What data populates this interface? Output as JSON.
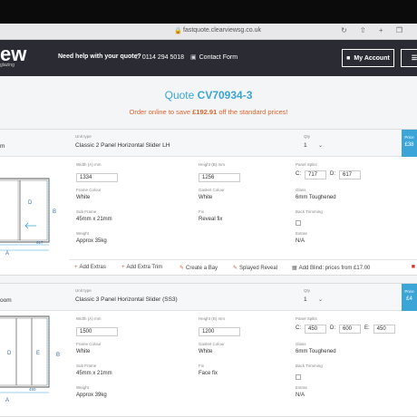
{
  "browser": {
    "url": "fastquote.clearviewsg.co.uk"
  },
  "header": {
    "logo_text": "ew",
    "logo_sub": "glazing",
    "help_text": "Need help with your quote?",
    "phone": "0114 294 5018",
    "contact": "Contact Form",
    "account_button": "My Account",
    "menu_icon": "hamburger-icon"
  },
  "quote": {
    "title_prefix": "Quote",
    "title_number": "CV70934-3",
    "promo_prefix": "Order online to save",
    "promo_amount": "£192.91",
    "promo_suffix": "off the standard prices!"
  },
  "labels": {
    "unit_type": "Unit type",
    "qty": "Qty",
    "price": "Price",
    "width": "Width (A) mm",
    "height": "Height (B) mm",
    "panel_splits": "Panel Splits",
    "frame_colour": "Frame Colour",
    "gasket_colour": "Gasket Colour",
    "glass": "Glass",
    "sub_frame": "Sub Frame",
    "fix": "Fix",
    "back_trimming": "Back Trimming",
    "weight": "Weight",
    "extras": "Extras"
  },
  "items": [
    {
      "room": "m",
      "unit_type": "Classic 2 Panel Horizontal Slider LH",
      "qty": "1",
      "price": "£38",
      "width": "1334",
      "height": "1256",
      "splits": [
        {
          "label": "C:",
          "value": "717"
        },
        {
          "label": "D:",
          "value": "617"
        }
      ],
      "frame_colour": "White",
      "gasket_colour": "White",
      "glass": "6mm Toughened",
      "sub_frame": "45mm x 21mm",
      "fix": "Reveal fix",
      "weight": "Approx 35kg",
      "extras": "N/A",
      "diagram_labels": {
        "d": "D",
        "b": "B",
        "a": "A",
        "dim": "617"
      }
    },
    {
      "room": "oom",
      "unit_type": "Classic 3 Panel Horizontal Slider (SS3)",
      "qty": "1",
      "price": "£4",
      "width": "1500",
      "height": "1200",
      "splits": [
        {
          "label": "C:",
          "value": "450"
        },
        {
          "label": "D:",
          "value": "600"
        },
        {
          "label": "E:",
          "value": "450"
        }
      ],
      "frame_colour": "White",
      "gasket_colour": "White",
      "glass": "6mm Toughened",
      "sub_frame": "45mm x 21mm",
      "fix": "Face fix",
      "weight": "Approx 39kg",
      "extras": "N/A",
      "diagram_labels": {
        "d": "D",
        "e": "E",
        "b": "B",
        "a": "A",
        "dim": "450"
      }
    }
  ],
  "actions": {
    "add_extras": "Add Extras",
    "add_extra_trim": "Add Extra Trim",
    "create_bay": "Create a Bay",
    "splayed_reveal": "Splayed Reveal",
    "add_blind": "Add Blind: prices from £17.00"
  },
  "colors": {
    "accent": "#3ba5d8",
    "promo": "#e2652f",
    "header_bg": "#2b2c33"
  }
}
